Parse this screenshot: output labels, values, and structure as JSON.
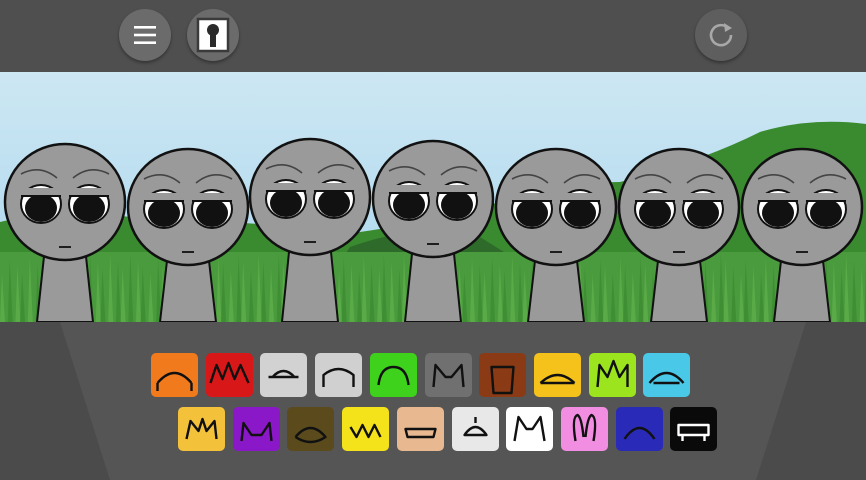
{
  "header": {
    "menu_icon": "hamburger-menu-icon",
    "profile_icon": "profile-card-icon",
    "reset_icon": "reset-arrow-icon"
  },
  "stage": {
    "character_count": 7,
    "character_color": "#9a9a9a",
    "sky_color": "#b9dcee",
    "grass_color": "#4a9b3d"
  },
  "palette": {
    "row1": [
      {
        "name": "orange-headphones",
        "color": "#f07a1c"
      },
      {
        "name": "red-spiky-hair",
        "color": "#d81818"
      },
      {
        "name": "gray-dish-hat",
        "color": "#d2d2d2"
      },
      {
        "name": "silver-helmet",
        "color": "#d0d0d0"
      },
      {
        "name": "green-leaf-hair",
        "color": "#3fd21c"
      },
      {
        "name": "gray-cat-ears",
        "color": "#707070"
      },
      {
        "name": "brown-bucket",
        "color": "#8a3a14"
      },
      {
        "name": "yellow-visor",
        "color": "#f4c21a"
      },
      {
        "name": "lime-spiky",
        "color": "#9be41e"
      },
      {
        "name": "teal-headphones",
        "color": "#4ac8e8"
      }
    ],
    "row2": [
      {
        "name": "yellow-crown",
        "color": "#f4c23a"
      },
      {
        "name": "purple-horns",
        "color": "#8a18c8"
      },
      {
        "name": "olive-hair",
        "color": "#5a4a1c"
      },
      {
        "name": "yellow-zigzag",
        "color": "#f4e21a"
      },
      {
        "name": "brown-hair",
        "color": "#e8b890"
      },
      {
        "name": "propeller-cap",
        "color": "#e8e8e8"
      },
      {
        "name": "white-cat-ears",
        "color": "#ffffff"
      },
      {
        "name": "pink-bunny-ears",
        "color": "#f28ee2"
      },
      {
        "name": "navy-dome",
        "color": "#2a2ab8"
      },
      {
        "name": "black-bench",
        "color": "#0a0a0a"
      }
    ]
  }
}
